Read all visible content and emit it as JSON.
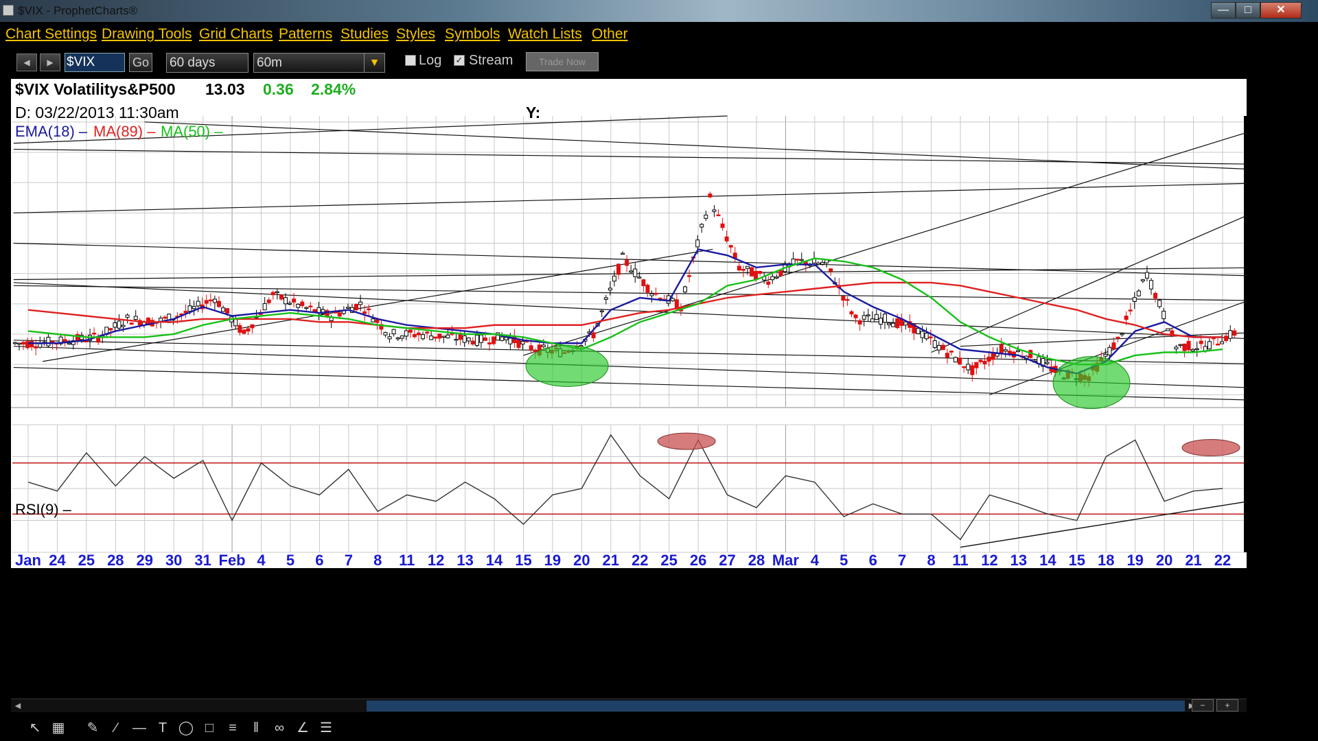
{
  "window": {
    "title": "$VIX - ProphetCharts®"
  },
  "menu": [
    "Chart Settings",
    "Drawing Tools",
    "Grid Charts",
    "Patterns",
    "Studies",
    "Styles",
    "Symbols",
    "Watch Lists",
    "Other"
  ],
  "toolbar": {
    "symbol": "$VIX",
    "go_label": "Go",
    "range": "60 days",
    "interval": "60m",
    "log_label": "Log",
    "log_checked": false,
    "stream_label": "Stream",
    "stream_checked": true,
    "trade_now_label": "Trade Now"
  },
  "header": {
    "symbol_name": "$VIX Volatilitys&P500",
    "last": "13.03",
    "change": "0.36",
    "change_pct": "2.84%",
    "date_line": "D:  03/22/2013  11:30am",
    "y_label": "Y:",
    "indicators": [
      {
        "label": "EMA(18)",
        "color": "#1a1aa0"
      },
      {
        "label": "MA(89)",
        "color": "#e02020"
      },
      {
        "label": "MA(50)",
        "color": "#16c016"
      }
    ],
    "rsi_label": "RSI(9)"
  },
  "chart_data": [
    {
      "type": "candlestick",
      "title": "$VIX Volatilitys&P500",
      "symbol": "$VIX",
      "last_price_tag": "13.03",
      "x_tick_labels": [
        "Jan",
        "24",
        "25",
        "28",
        "29",
        "30",
        "31",
        "Feb",
        "4",
        "5",
        "6",
        "7",
        "8",
        "11",
        "12",
        "13",
        "14",
        "15",
        "19",
        "20",
        "21",
        "22",
        "25",
        "26",
        "27",
        "28",
        "Mar",
        "4",
        "5",
        "6",
        "7",
        "8",
        "11",
        "12",
        "13",
        "14",
        "15",
        "18",
        "19",
        "20",
        "21",
        "22"
      ],
      "y_ticks": [
        11,
        12,
        13,
        14,
        15,
        16,
        17,
        18,
        19,
        20
      ],
      "ylim": [
        10.6,
        20.2
      ],
      "sessions": [
        "Jan 23",
        "Jan 24",
        "Jan 25",
        "Jan 28",
        "Jan 29",
        "Jan 30",
        "Jan 31",
        "Feb 1",
        "Feb 4",
        "Feb 5",
        "Feb 6",
        "Feb 7",
        "Feb 8",
        "Feb 11",
        "Feb 12",
        "Feb 13",
        "Feb 14",
        "Feb 15",
        "Feb 19",
        "Feb 20",
        "Feb 21",
        "Feb 22",
        "Feb 25",
        "Feb 26",
        "Feb 27",
        "Feb 28",
        "Mar 1",
        "Mar 4",
        "Mar 5",
        "Mar 6",
        "Mar 7",
        "Mar 8",
        "Mar 11",
        "Mar 12",
        "Mar 13",
        "Mar 14",
        "Mar 15",
        "Mar 18",
        "Mar 19",
        "Mar 20",
        "Mar 21",
        "Mar 22"
      ],
      "session_closes": [
        12.7,
        12.8,
        12.9,
        13.5,
        13.4,
        13.7,
        14.2,
        13.0,
        14.3,
        13.9,
        13.6,
        14.0,
        13.0,
        13.0,
        12.9,
        12.8,
        12.9,
        12.5,
        12.4,
        13.0,
        15.5,
        14.4,
        13.9,
        17.5,
        15.2,
        14.8,
        15.4,
        15.3,
        13.5,
        13.5,
        13.2,
        12.5,
        11.8,
        12.5,
        12.3,
        11.7,
        11.6,
        12.8,
        15.0,
        12.6,
        12.6,
        13.03
      ],
      "series": [
        {
          "name": "EMA(18)",
          "color": "#1a1aa0",
          "values": [
            12.7,
            12.7,
            12.8,
            13.1,
            13.3,
            13.5,
            13.9,
            13.6,
            13.7,
            13.8,
            13.7,
            13.8,
            13.5,
            13.3,
            13.2,
            13.1,
            13.0,
            12.8,
            12.7,
            12.7,
            13.8,
            14.2,
            14.1,
            15.8,
            15.6,
            15.2,
            15.3,
            15.3,
            14.4,
            13.9,
            13.5,
            13.0,
            12.5,
            12.4,
            12.3,
            11.9,
            11.7,
            12.1,
            13.1,
            13.4,
            12.9,
            12.9
          ]
        },
        {
          "name": "MA(89)",
          "color": "#e02020",
          "values": [
            13.8,
            13.7,
            13.6,
            13.5,
            13.4,
            13.4,
            13.5,
            13.5,
            13.5,
            13.5,
            13.4,
            13.4,
            13.3,
            13.2,
            13.2,
            13.2,
            13.3,
            13.3,
            13.3,
            13.3,
            13.5,
            13.7,
            13.8,
            14.0,
            14.2,
            14.3,
            14.4,
            14.5,
            14.6,
            14.7,
            14.7,
            14.7,
            14.6,
            14.4,
            14.2,
            14.0,
            13.8,
            13.5,
            13.3,
            13.0,
            12.9,
            12.9
          ]
        },
        {
          "name": "MA(50)",
          "color": "#16c016",
          "values": [
            13.1,
            13.0,
            12.9,
            12.9,
            12.9,
            13.0,
            13.3,
            13.5,
            13.6,
            13.7,
            13.6,
            13.5,
            13.3,
            13.2,
            13.1,
            13.0,
            13.0,
            12.9,
            12.7,
            12.5,
            12.9,
            13.4,
            13.7,
            14.0,
            14.6,
            14.8,
            15.2,
            15.5,
            15.4,
            15.2,
            14.8,
            14.2,
            13.4,
            12.9,
            12.5,
            12.2,
            12.0,
            12.0,
            12.3,
            12.4,
            12.4,
            12.5
          ]
        }
      ],
      "annotations": [
        "green ellipse near Feb 15–19 lows",
        "green ellipse near Mar 14–15 lows",
        "multiple black trendlines"
      ]
    },
    {
      "type": "line",
      "title": "RSI(9)",
      "y_ticks": [
        0,
        25,
        50,
        75,
        100
      ],
      "ylim": [
        0,
        100
      ],
      "reference_lines": [
        30,
        70
      ],
      "sessions": [
        "Jan 23",
        "Jan 24",
        "Jan 25",
        "Jan 28",
        "Jan 29",
        "Jan 30",
        "Jan 31",
        "Feb 1",
        "Feb 4",
        "Feb 5",
        "Feb 6",
        "Feb 7",
        "Feb 8",
        "Feb 11",
        "Feb 12",
        "Feb 13",
        "Feb 14",
        "Feb 15",
        "Feb 19",
        "Feb 20",
        "Feb 21",
        "Feb 22",
        "Feb 25",
        "Feb 26",
        "Feb 27",
        "Feb 28",
        "Mar 1",
        "Mar 4",
        "Mar 5",
        "Mar 6",
        "Mar 7",
        "Mar 8",
        "Mar 11",
        "Mar 12",
        "Mar 13",
        "Mar 14",
        "Mar 15",
        "Mar 18",
        "Mar 19",
        "Mar 20",
        "Mar 21",
        "Mar 22"
      ],
      "values": [
        55,
        48,
        78,
        52,
        75,
        58,
        72,
        25,
        70,
        52,
        45,
        65,
        32,
        45,
        40,
        55,
        42,
        22,
        45,
        50,
        92,
        60,
        42,
        88,
        45,
        35,
        60,
        55,
        28,
        38,
        30,
        30,
        10,
        45,
        38,
        30,
        25,
        75,
        88,
        40,
        48,
        50
      ],
      "annotations": [
        "red ellipse near Feb 22 peak",
        "red ellipse near Mar 20 peak",
        "rising black trendline"
      ]
    }
  ]
}
